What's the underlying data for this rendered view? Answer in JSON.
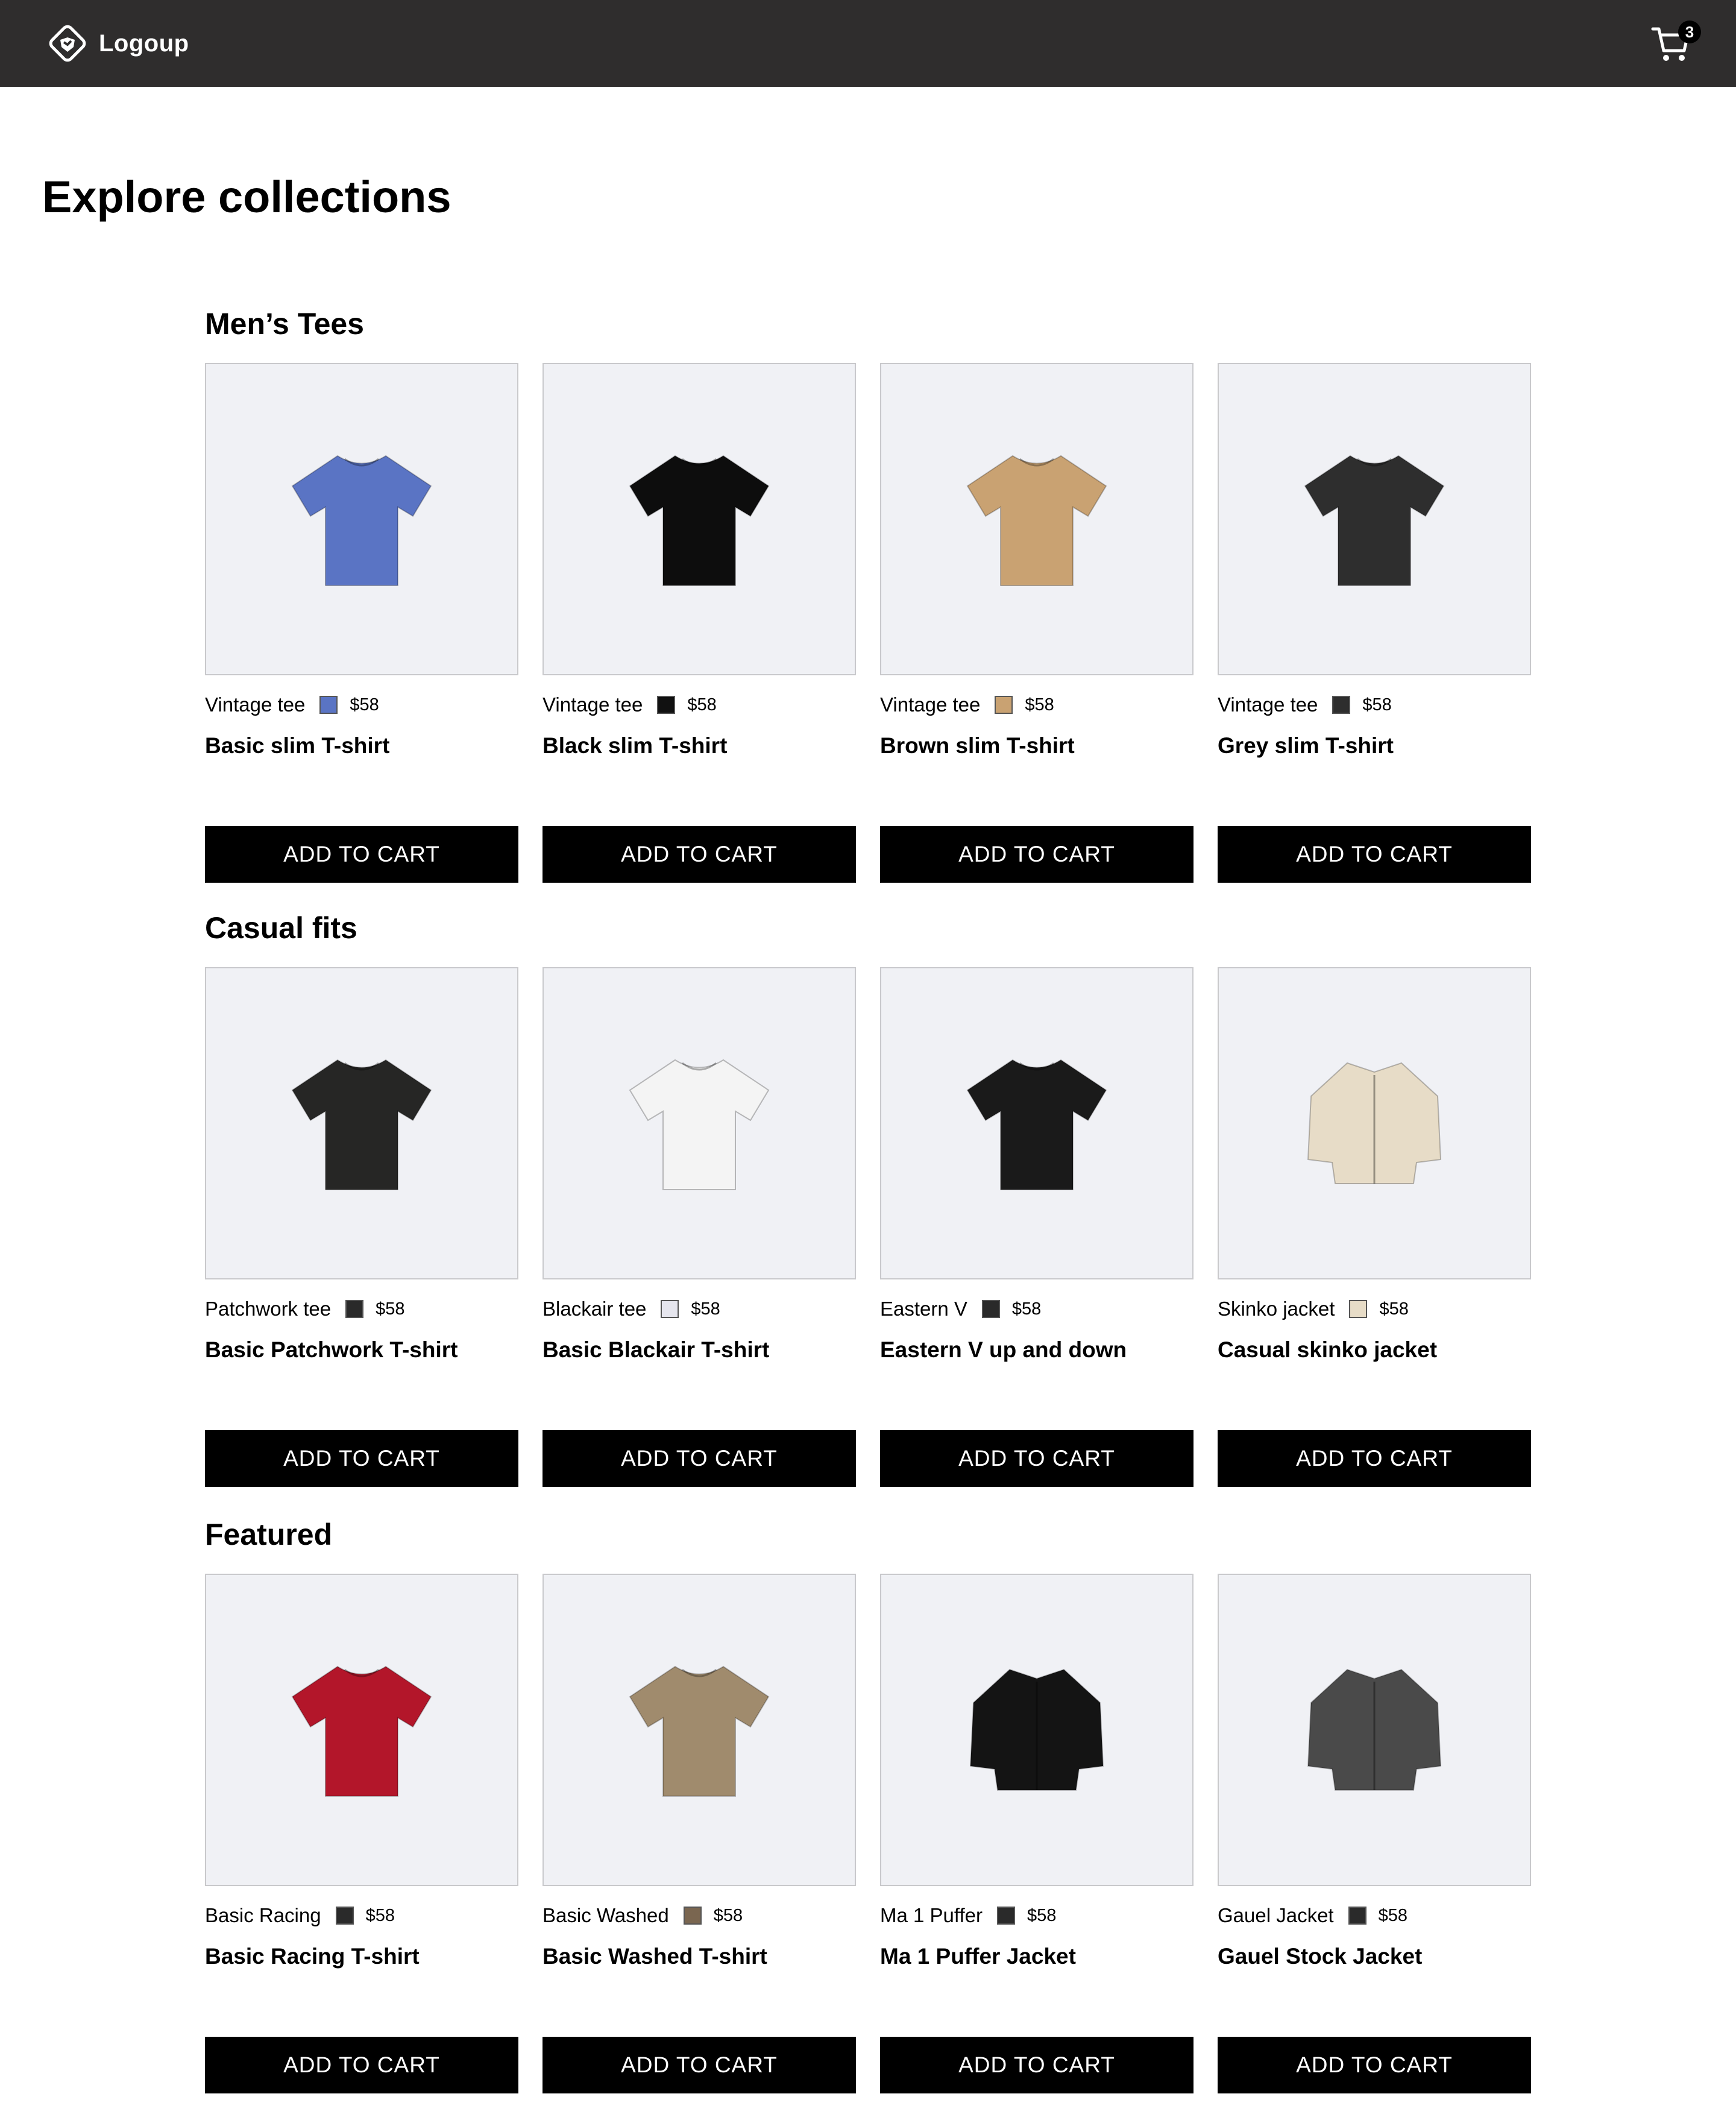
{
  "brand": {
    "name": "Logoup"
  },
  "cart": {
    "count": "3"
  },
  "page": {
    "title": "Explore collections"
  },
  "button_label": "ADD TO CART",
  "sections": [
    {
      "title": "Men’s Tees",
      "products": [
        {
          "category": "Vintage tee",
          "swatch": "#5a74c4",
          "price": "$58",
          "name": "Basic slim T-shirt",
          "image": "tshirt",
          "color": "#5a74c4"
        },
        {
          "category": "Vintage tee",
          "swatch": "#111111",
          "price": "$58",
          "name": "Black slim T-shirt",
          "image": "tshirt",
          "color": "#0d0d0d"
        },
        {
          "category": "Vintage tee",
          "swatch": "#c9a272",
          "price": "$58",
          "name": "Brown slim T-shirt",
          "image": "tshirt",
          "color": "#c9a272"
        },
        {
          "category": "Vintage tee",
          "swatch": "#2e2e2e",
          "price": "$58",
          "name": "Grey slim T-shirt",
          "image": "tshirt",
          "color": "#2e2e2e"
        }
      ]
    },
    {
      "title": "Casual fits",
      "products": [
        {
          "category": "Patchwork tee",
          "swatch": "#2a2a2a",
          "price": "$58",
          "name": "Basic Patchwork T-shirt",
          "image": "tshirt",
          "color": "#262625"
        },
        {
          "category": "Blackair tee",
          "swatch": "#e6e6ee",
          "price": "$58",
          "name": "Basic Blackair T-shirt",
          "image": "tshirt",
          "color": "#f4f4f4"
        },
        {
          "category": "Eastern V",
          "swatch": "#2a2a2a",
          "price": "$58",
          "name": "Eastern V up and down",
          "image": "tshirt",
          "color": "#1a1a1a"
        },
        {
          "category": "Skinko jacket",
          "swatch": "#e7dcc7",
          "price": "$58",
          "name": "Casual skinko jacket",
          "image": "jacket",
          "color": "#e7dcc7"
        }
      ]
    },
    {
      "title": "Featured",
      "products": [
        {
          "category": "Basic Racing",
          "swatch": "#2a2a2a",
          "price": "$58",
          "name": "Basic Racing T-shirt",
          "image": "tshirt",
          "color": "#b3162a"
        },
        {
          "category": "Basic Washed",
          "swatch": "#7a6650",
          "price": "$58",
          "name": "Basic Washed T-shirt",
          "image": "tshirt",
          "color": "#a08b6d"
        },
        {
          "category": "Ma 1 Puffer",
          "swatch": "#2a2a2a",
          "price": "$58",
          "name": "Ma 1 Puffer Jacket",
          "image": "jacket",
          "color": "#141414"
        },
        {
          "category": "Gauel Jacket",
          "swatch": "#2a2a2a",
          "price": "$58",
          "name": "Gauel Stock Jacket",
          "image": "jacket",
          "color": "#4a4a4a"
        }
      ]
    }
  ]
}
